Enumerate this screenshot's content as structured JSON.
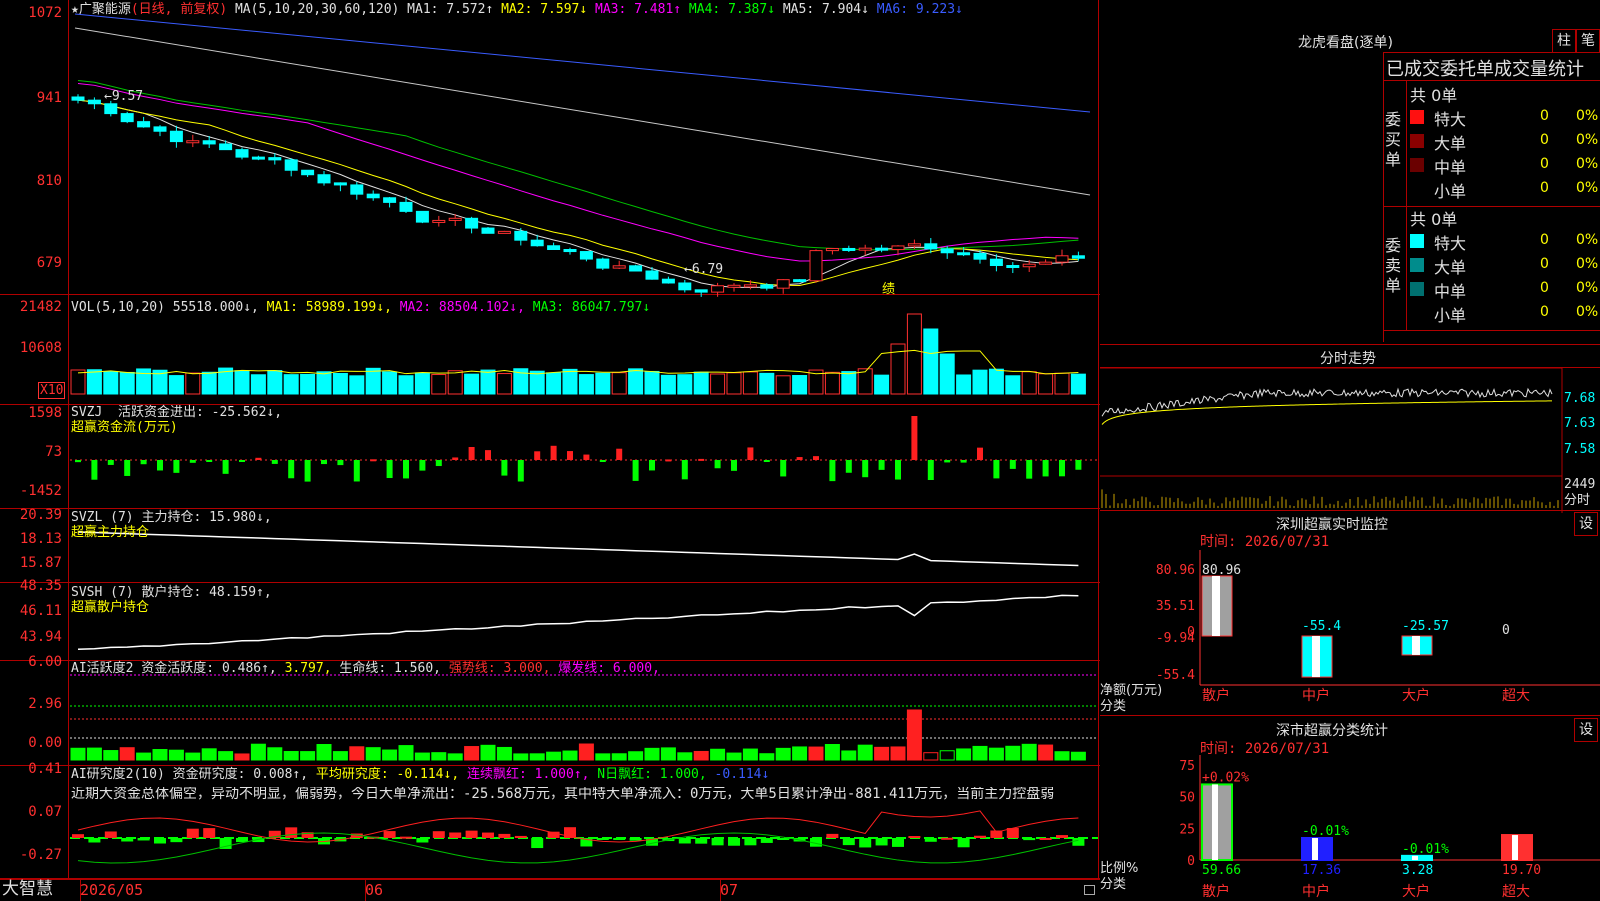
{
  "app": {
    "brand": "大智慧"
  },
  "kline": {
    "header": [
      {
        "text": "★",
        "cls": "w"
      },
      {
        "text": "广聚能源",
        "cls": "w"
      },
      {
        "text": "(日线, 前复权)",
        "cls": "r"
      },
      {
        "text": " MA(5,10,20,30,60,120) ",
        "cls": "w"
      },
      {
        "text": "MA1: 7.572↑",
        "cls": "w"
      },
      {
        "text": " MA2: 7.597↓",
        "cls": "y"
      },
      {
        "text": " MA3: 7.481↑",
        "cls": "m"
      },
      {
        "text": " MA4: 7.387↓",
        "cls": "g"
      },
      {
        "text": " MA5: 7.904↓",
        "cls": "w"
      },
      {
        "text": " MA6: 9.223↓",
        "cls": "b"
      }
    ],
    "axis": [
      "1072",
      "941",
      "810",
      "679"
    ],
    "high_label": "←9.57",
    "low_label": "←6.79",
    "note": "绩"
  },
  "vol": {
    "header": [
      {
        "text": "VOL(5,10,20) ",
        "cls": "w"
      },
      {
        "text": "55518.000↓,",
        "cls": "w"
      },
      {
        "text": " MA1: 58989.199↓,",
        "cls": "y"
      },
      {
        "text": " MA2: 88504.102↓,",
        "cls": "m"
      },
      {
        "text": " MA3: 86047.797↓",
        "cls": "g"
      }
    ],
    "axis": [
      "21482",
      "10608"
    ],
    "unit": "X10"
  },
  "svzj": {
    "header": [
      {
        "text": "SVZJ  活跃资金进出: -25.562↓,",
        "cls": "w"
      }
    ],
    "sub": "超赢资金流(万元)",
    "axis": [
      "1598",
      "73",
      "-1452"
    ]
  },
  "svzl": {
    "header": [
      {
        "text": "SVZL (7) 主力持仓: 15.980↓,",
        "cls": "w"
      }
    ],
    "sub": "超赢主力持仓",
    "axis": [
      "20.39",
      "18.13",
      "15.87"
    ]
  },
  "svsh": {
    "header": [
      {
        "text": "SVSH (7) 散户持仓: 48.159↑,",
        "cls": "w"
      }
    ],
    "sub": "超赢散户持仓",
    "axis": [
      "48.35",
      "46.11",
      "43.94"
    ]
  },
  "ai1": {
    "header": [
      {
        "text": "AI活跃度2 资金活跃度: 0.486↑,",
        "cls": "w"
      },
      {
        "text": " 3.797,",
        "cls": "y"
      },
      {
        "text": " 生命线: 1.560,",
        "cls": "w"
      },
      {
        "text": " 强势线: 3.000,",
        "cls": "r"
      },
      {
        "text": " 爆发线: 6.000,",
        "cls": "m"
      }
    ],
    "axis": [
      "6.00",
      "2.96",
      "0.00"
    ]
  },
  "ai2": {
    "header": [
      {
        "text": "AI研究度2(10) 资金研究度: 0.008↑,",
        "cls": "w"
      },
      {
        "text": " 平均研究度: -0.114↓,",
        "cls": "y"
      },
      {
        "text": " 连续飘红: 1.000↑,",
        "cls": "m"
      },
      {
        "text": " N日飘红: 1.000,",
        "cls": "g"
      },
      {
        "text": " -0.114↓",
        "cls": "b"
      }
    ],
    "text": "近期大资金总体偏空，异动不明显，偏弱势，今日大单净流出：-25.568万元，其中特大单净流入：0万元，大单5日累计净出-881.411万元，当前主力控盘弱",
    "axis": [
      "0.41",
      "0.07",
      "-0.27"
    ]
  },
  "dates": [
    "2026/05",
    "06",
    "07"
  ],
  "right": {
    "lhb_title": "龙虎看盘(逐单)",
    "btn1": "柱",
    "btn2": "笔",
    "order_title": "已成交委托单成交量统计",
    "buy": {
      "label": "委买单",
      "total": "共 0单",
      "rows": [
        {
          "name": "特大",
          "n": "0",
          "p": "0%",
          "color": "#ff1010"
        },
        {
          "name": "大单",
          "n": "0",
          "p": "0%",
          "color": "#8a0000"
        },
        {
          "name": "中单",
          "n": "0",
          "p": "0%",
          "color": "#6a0000"
        },
        {
          "name": "小单",
          "n": "0",
          "p": "0%",
          "color": "#000000"
        }
      ]
    },
    "sell": {
      "label": "委卖单",
      "total": "共 0单",
      "rows": [
        {
          "name": "特大",
          "n": "0",
          "p": "0%",
          "color": "#00ffff"
        },
        {
          "name": "大单",
          "n": "0",
          "p": "0%",
          "color": "#008c8c"
        },
        {
          "name": "中单",
          "n": "0",
          "p": "0%",
          "color": "#007070"
        },
        {
          "name": "小单",
          "n": "0",
          "p": "0%",
          "color": "#000000"
        }
      ]
    },
    "fenshi": {
      "title": "分时走势",
      "axis": [
        "7.68",
        "7.63",
        "7.58"
      ],
      "vol_axis": [
        "2449",
        "分时"
      ]
    },
    "sz_monitor": {
      "title": "深圳超赢实时监控",
      "btn": "设",
      "time": "时间: 2026/07/31",
      "axis": [
        "80.96",
        "35.51",
        "0",
        "-9.94",
        "-55.4"
      ],
      "ylabel": "净额(万元)",
      "xlabel": "分类",
      "values": [
        {
          "cat": "散户",
          "label": "80.96",
          "v": 80.96
        },
        {
          "cat": "中户",
          "label": "-55.4",
          "v": -55.4
        },
        {
          "cat": "大户",
          "label": "-25.57",
          "v": -25.57
        },
        {
          "cat": "超大",
          "label": "0",
          "v": 0
        }
      ]
    },
    "sz_class": {
      "title": "深市超赢分类统计",
      "btn": "设",
      "time": "时间: 2026/07/31",
      "axis": [
        "75",
        "50",
        "25",
        "0"
      ],
      "ylabel": "比例%",
      "xlabel": "分类",
      "values": [
        {
          "cat": "散户",
          "top": "+0.02%",
          "bottom": "59.66",
          "v": 59.66
        },
        {
          "cat": "中户",
          "top": "-0.01%",
          "bottom": "17.36",
          "v": 17.36
        },
        {
          "cat": "大户",
          "top": "-0.01%",
          "bottom": "3.28",
          "v": 3.28
        },
        {
          "cat": "超大",
          "top": "",
          "bottom": "19.70",
          "v": 19.7
        }
      ]
    }
  },
  "chart_data": [
    {
      "type": "bar",
      "title": "深圳超赢实时监控",
      "ylabel": "净额(万元)",
      "xlabel": "分类",
      "categories": [
        "散户",
        "中户",
        "大户",
        "超大"
      ],
      "values": [
        80.96,
        -55.4,
        -25.57,
        0
      ],
      "ylim": [
        -55.4,
        80.96
      ]
    },
    {
      "type": "bar",
      "title": "深市超赢分类统计",
      "ylabel": "比例%",
      "xlabel": "分类",
      "categories": [
        "散户",
        "中户",
        "大户",
        "超大"
      ],
      "values": [
        59.66,
        17.36,
        3.28,
        19.7
      ],
      "ylim": [
        0,
        75
      ]
    }
  ]
}
